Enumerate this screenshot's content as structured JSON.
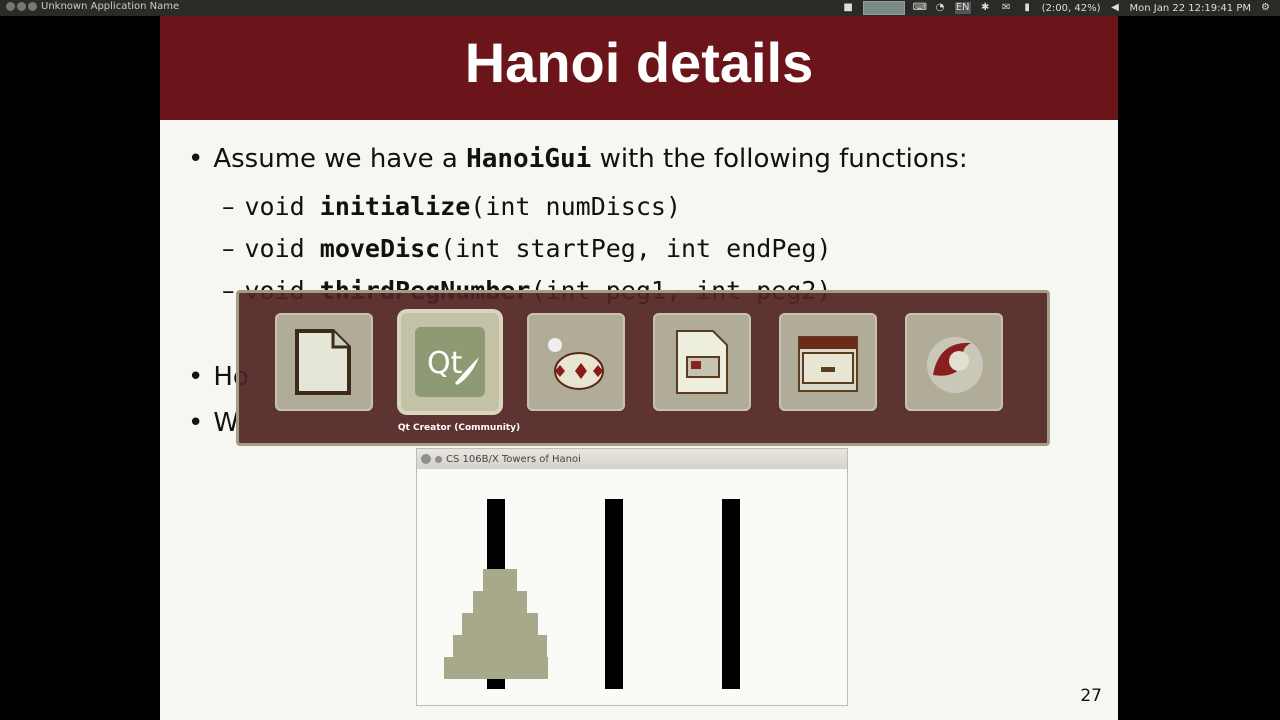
{
  "topbar": {
    "app_name": "Unknown Application Name",
    "battery": "(2:00, 42%)",
    "clock": "Mon Jan 22 12:19:41 PM",
    "lang": "EN"
  },
  "slide": {
    "title": "Hanoi details",
    "bullet1_pre": "Assume we have a ",
    "bullet1_bold": "HanoiGui",
    "bullet1_post": " with the following functions:",
    "sub1_kw": "void ",
    "sub1_bold": "initialize",
    "sub1_rest": "(int numDiscs)",
    "sub2_kw": "void ",
    "sub2_bold": "moveDisc",
    "sub2_rest": "(int startPeg, int endPeg)",
    "sub3_kw": "void ",
    "sub3_bold": "thirdPegNumber",
    "sub3_rest": "(int peg1, int peg2)",
    "bullet2": "Ho",
    "bullet3": "W",
    "page_number": "27"
  },
  "hanoi_window": {
    "title": "CS 106B/X Towers of Hanoi",
    "disc_count": 5
  },
  "switcher": {
    "apps": [
      {
        "name": "libreoffice-icon"
      },
      {
        "name": "qt-creator-icon",
        "text": "Qt"
      },
      {
        "name": "teapot-icon"
      },
      {
        "name": "impress-icon"
      },
      {
        "name": "file-cabinet-icon"
      },
      {
        "name": "firefox-icon"
      }
    ],
    "selected_label": "Qt Creator (Community)"
  }
}
